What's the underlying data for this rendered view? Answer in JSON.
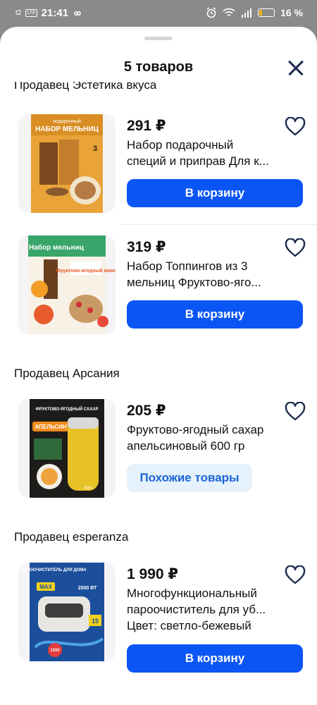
{
  "status": {
    "network": "LTE",
    "time": "21:41",
    "battery": "16 %"
  },
  "sheet": {
    "title": "5 товаров",
    "close_label": "close"
  },
  "groups": [
    {
      "seller": "Продавец Эстетика вкуса"
    },
    {
      "seller": "Продавец Арсания"
    },
    {
      "seller": "Продавец esperanza"
    }
  ],
  "products": [
    {
      "price": "291 ₽",
      "name1": "Набор подарочный",
      "name2": "специй и приправ Для к...",
      "button": "В корзину",
      "thumb_text1": "подарочный",
      "thumb_text2": "НАБОР МЕЛЬНИЦ",
      "thumb_text3": "3"
    },
    {
      "price": "319 ₽",
      "name1": "Набор Топпингов из 3",
      "name2": "мельниц Фруктово-яго...",
      "button": "В корзину",
      "thumb_text1": "Набор мельниц",
      "thumb_text2": "Фруктово-ягодный микс"
    },
    {
      "price": "205 ₽",
      "name1": "Фруктово-ягодный сахар",
      "name2": "апельсиновый 600 гр",
      "button": "Похожие товары",
      "thumb_text1": "ФРУКТОВО-ЯГОДНЫЙ САХАР",
      "thumb_text2": "АПЕЛЬСИН",
      "thumb_text3": "600 г"
    },
    {
      "price": "1 990 ₽",
      "name1": "Многофункциональный",
      "name2": "пароочиститель для уб...",
      "attr": "Цвет: светло-бежевый",
      "button": "В корзину",
      "thumb_text1": "ПАРООЧИСТИТЕЛЬ ДЛЯ ДОМА",
      "thumb_text2": "MAX",
      "thumb_text3": "2500 ВТ",
      "thumb_text4": "15",
      "thumb_text5": "1200"
    }
  ]
}
